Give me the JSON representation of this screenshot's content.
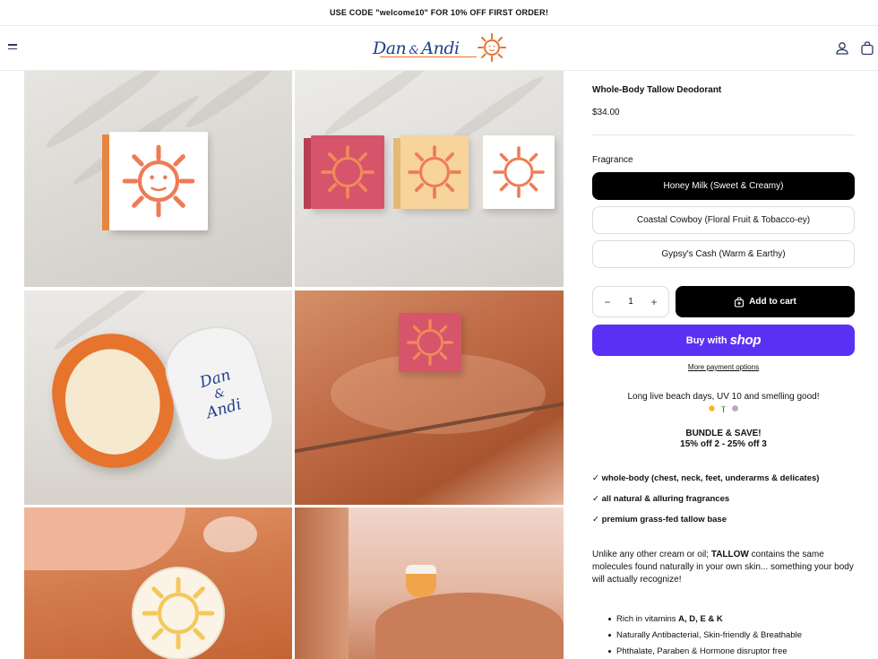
{
  "announcement": "USE CODE \"welcome10\" FOR 10% OFF FIRST ORDER!",
  "brand": {
    "name_left": "Dan",
    "amp": "&",
    "name_right": "Andi",
    "accent": "#e8732e",
    "ink": "#1f3f8a"
  },
  "header_icons": [
    "menu-icon",
    "account-icon",
    "bag-icon"
  ],
  "gallery": [
    {
      "name": "tallow-box-white"
    },
    {
      "name": "tallow-boxes-trio"
    },
    {
      "name": "tallow-jar-open"
    },
    {
      "name": "model-holding-box"
    },
    {
      "name": "applying-tallow"
    },
    {
      "name": "model-holding-jar"
    }
  ],
  "product": {
    "title": "Whole-Body Tallow Deodorant",
    "price": "$34.00",
    "option_label": "Fragrance",
    "options": [
      {
        "label": "Honey Milk (Sweet & Creamy)",
        "selected": true
      },
      {
        "label": "Coastal Cowboy (Floral Fruit & Tobacco-ey)",
        "selected": false
      },
      {
        "label": "Gypsy's Cash (Warm & Earthy)",
        "selected": false
      }
    ],
    "quantity": "1",
    "qty_minus": "−",
    "qty_plus": "+",
    "add_to_cart": "Add to cart",
    "buy_with": "Buy with",
    "shop_brand": "shop",
    "more_payment": "More payment options"
  },
  "description": {
    "tagline": "Long live beach days, UV 10 and smelling good!",
    "emojis": [
      "sun-emoji",
      "palm-tree-emoji",
      "shell-emoji"
    ],
    "bundle_title": "BUNDLE & SAVE!",
    "bundle_detail": "15% off 2 - 25% off 3",
    "checks": [
      "✓ whole-body (chest, neck, feet, underarms & delicates)",
      "✓ all natural & alluring fragrances",
      "✓ premium grass-fed tallow base"
    ],
    "para_before": "Unlike any other cream or oil; ",
    "para_bold": "TALLOW",
    "para_after": " contains the same molecules found naturally in your own skin... something your body will actually recognize!",
    "bullets": {
      "vitamins_prefix": "Rich in vitamins ",
      "vitamins_bold": "A, D, E & K",
      "item2": "Naturally Antibacterial, Skin-friendly & Breathable",
      "item3": "Phthalate, Paraben & Hormone disruptor free"
    }
  },
  "colors": {
    "shop_purple": "#5a31f4",
    "sun_orange": "#e8732e",
    "box_pink": "#d6556a",
    "box_yellow": "#f6d49b"
  }
}
